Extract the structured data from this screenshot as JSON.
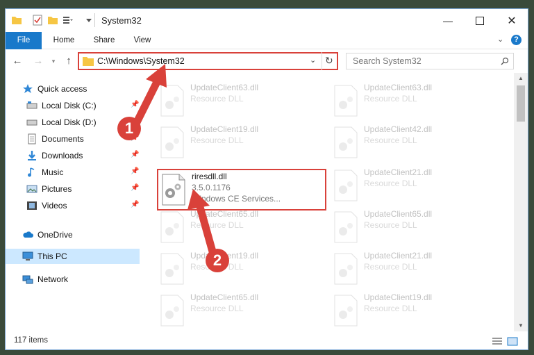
{
  "window": {
    "title": "System32",
    "controls": [
      "minimize-icon",
      "maximize-icon",
      "close-icon"
    ]
  },
  "ribbon": {
    "tabs": [
      "File",
      "Home",
      "Share",
      "View"
    ]
  },
  "address": {
    "path": "C:\\Windows\\System32"
  },
  "search": {
    "placeholder": "Search System32"
  },
  "sidebar": {
    "items": [
      {
        "label": "Quick access",
        "icon": "star-icon"
      },
      {
        "label": "Local Disk (C:)",
        "icon": "drive-icon",
        "pinned": true
      },
      {
        "label": "Local Disk (D:)",
        "icon": "drive-icon",
        "pinned": true
      },
      {
        "label": "Documents",
        "icon": "documents-icon",
        "pinned": true
      },
      {
        "label": "Downloads",
        "icon": "download-icon",
        "pinned": true
      },
      {
        "label": "Music",
        "icon": "music-icon",
        "pinned": true
      },
      {
        "label": "Pictures",
        "icon": "pictures-icon",
        "pinned": true
      },
      {
        "label": "Videos",
        "icon": "videos-icon",
        "pinned": true
      },
      {
        "label": "OneDrive",
        "icon": "cloud-icon"
      },
      {
        "label": "This PC",
        "icon": "monitor-icon",
        "selected": true
      },
      {
        "label": "Network",
        "icon": "network-icon"
      }
    ]
  },
  "files": [
    {
      "name": "UpdateClient63.dll",
      "desc": "Resource DLL"
    },
    {
      "name": "UpdateClient63.dll",
      "desc": "Resource DLL"
    },
    {
      "name": "UpdateClient19.dll",
      "desc": "Resource DLL"
    },
    {
      "name": "UpdateClient42.dll",
      "desc": "Resource DLL"
    },
    {
      "name": "riresdll.dll",
      "desc": "3.5.0.1176",
      "desc2": "Windows CE Services..."
    },
    {
      "name": "UpdateClient21.dll",
      "desc": "Resource DLL"
    },
    {
      "name": "UpdateClient65.dll",
      "desc": "Resource DLL"
    },
    {
      "name": "UpdateClient65.dll",
      "desc": "Resource DLL"
    },
    {
      "name": "UpdateClient19.dll",
      "desc": "Resource DLL"
    },
    {
      "name": "UpdateClient21.dll",
      "desc": "Resource DLL"
    },
    {
      "name": "UpdateClient65.dll",
      "desc": "Resource DLL"
    },
    {
      "name": "UpdateClient19.dll",
      "desc": "Resource DLL"
    }
  ],
  "status": {
    "items": "117 items"
  },
  "callouts": [
    "1",
    "2"
  ],
  "colors": {
    "accent": "#1979ca",
    "highlight": "#d9413a"
  }
}
